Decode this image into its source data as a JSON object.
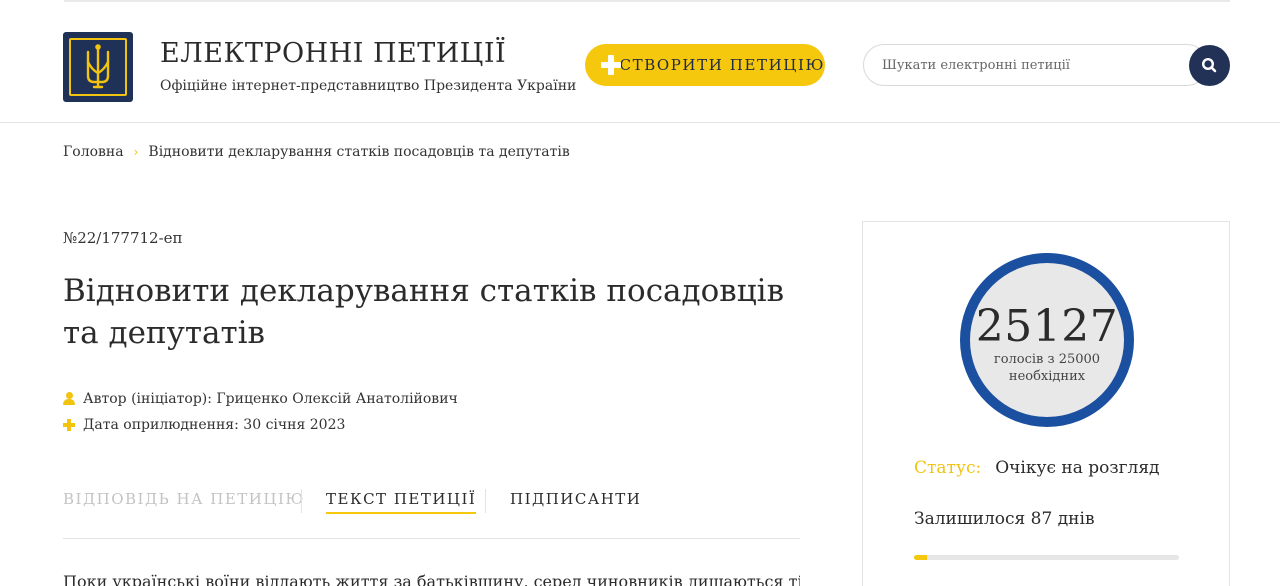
{
  "header": {
    "title": "ЕЛЕКТРОННІ ПЕТИЦІЇ",
    "subtitle": "Офіційне інтернет-представництво Президента України",
    "create_button": "СТВОРИТИ ПЕТИЦІЮ",
    "search_placeholder": "Шукати електронні петиції"
  },
  "breadcrumb": {
    "home": "Головна",
    "current": "Відновити декларування статків посадовців та депутатів"
  },
  "petition": {
    "number": "№22/177712-еп",
    "title": "Відновити декларування статків посадовців та депутатів",
    "author": "Автор (ініціатор): Гриценко Олексій Анатолійович",
    "date": "Дата оприлюднення: 30 січня 2023",
    "text_preview": "Поки українські воїни віддають життя за батьківщину, серед чиновників лишаються ті, хто"
  },
  "tabs": {
    "answer": "ВІДПОВІДЬ НА ПЕТИЦІЮ",
    "text": "ТЕКСТ ПЕТИЦІЇ",
    "signers": "ПІДПИСАНТИ"
  },
  "sidebar": {
    "votes": "25127",
    "votes_caption": "голосів з 25000 необхідних",
    "status_label": "Статус:",
    "status_value": "Очікує на розгляд",
    "remaining": "Залишилося 87 днів",
    "remaining_progress": 0.05
  },
  "colors": {
    "accent_yellow": "#f5c70d",
    "navy": "#223257",
    "ring_blue": "#1b4fa0"
  },
  "icons": [
    "trident-logo-icon",
    "plus-icon",
    "search-icon",
    "chevron-right-icon",
    "user-icon",
    "plus-small-icon"
  ]
}
